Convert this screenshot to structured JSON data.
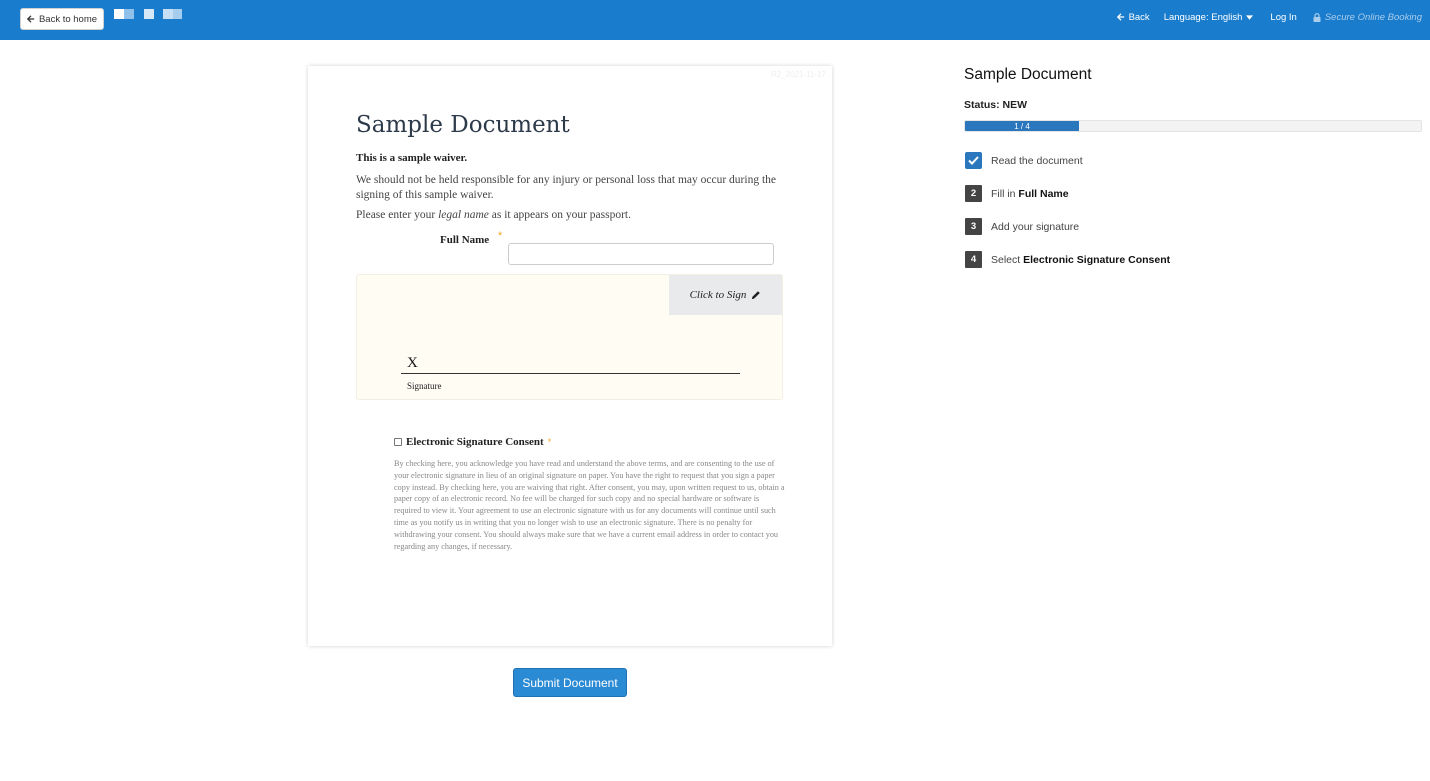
{
  "topbar": {
    "back_home_label": "Back to home",
    "back_label": "Back",
    "language_label": "Language: English",
    "login_label": "Log In",
    "secure_label": "Secure Online Booking",
    "brand_color": "#1a7ccc"
  },
  "document": {
    "id_text": "R2_2021-11-17",
    "title": "Sample Document",
    "intro_bold": "This is a sample waiver.",
    "responsibility": "We should not be held responsible for any injury or personal loss that may occur during the signing of this sample waiver.",
    "legal_prefix": "Please enter your ",
    "legal_em": "legal name",
    "legal_suffix": " as it appears on your passport.",
    "full_name_label": "Full Name",
    "full_name_value": "",
    "required_mark": "*",
    "click_to_sign": "Click to Sign",
    "signature_x": "X",
    "signature_label": "Signature",
    "consent_label": "Electronic Signature Consent",
    "consent_checked": false,
    "consent_text": "By checking here, you acknowledge you have read and understand the above terms, and are consenting to the use of your electronic signature in lieu of an original signature on paper. You have the right to request that you sign a paper copy instead. By checking here, you are waiving that right. After consent, you may, upon written request to us, obtain a paper copy of an electronic record. No fee will be charged for such copy and no special hardware or software is required to view it. Your agreement to use an electronic signature with us for any documents will continue until such time as you notify us in writing that you no longer wish to use an electronic signature. There is no penalty for withdrawing your consent. You should always make sure that we have a current email address in order to contact you regarding any changes, if necessary."
  },
  "submit_label": "Submit Document",
  "sidebar": {
    "title": "Sample Document",
    "status": "Status: NEW",
    "progress_text": "1 / 4",
    "progress_fraction": 0.25,
    "steps": [
      {
        "marker": "check",
        "prefix": "Read the document",
        "bold": ""
      },
      {
        "marker": "2",
        "prefix": "Fill in ",
        "bold": "Full Name"
      },
      {
        "marker": "3",
        "prefix": "Add your signature",
        "bold": ""
      },
      {
        "marker": "4",
        "prefix": "Select ",
        "bold": "Electronic Signature Consent"
      }
    ]
  },
  "icons": {
    "back_arrow": "arrow-left-icon",
    "caret": "caret-down-icon",
    "lock": "lock-icon",
    "pencil": "pencil-icon",
    "check": "check-icon"
  }
}
